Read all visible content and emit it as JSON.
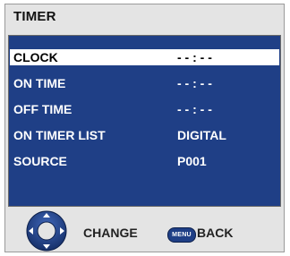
{
  "header": {
    "title": "TIMER"
  },
  "menu": {
    "items": [
      {
        "label": "CLOCK",
        "value": "- - : - -",
        "selected": true
      },
      {
        "label": "ON TIME",
        "value": "- - : - -",
        "selected": false
      },
      {
        "label": "OFF TIME",
        "value": "- - : - -",
        "selected": false
      },
      {
        "label": "ON TIMER LIST",
        "value": "DIGITAL",
        "selected": false
      },
      {
        "label": "SOURCE",
        "value": "P001",
        "selected": false
      }
    ]
  },
  "footer": {
    "change_label": "CHANGE",
    "menu_button_label": "MENU",
    "back_label": "BACK",
    "icons": [
      "dpad-icon",
      "menu-button-icon"
    ]
  },
  "colors": {
    "panel": "#1f3f86",
    "frame": "#e4e4e4",
    "selected_row": "#ffffff",
    "text": "#ffffff"
  }
}
